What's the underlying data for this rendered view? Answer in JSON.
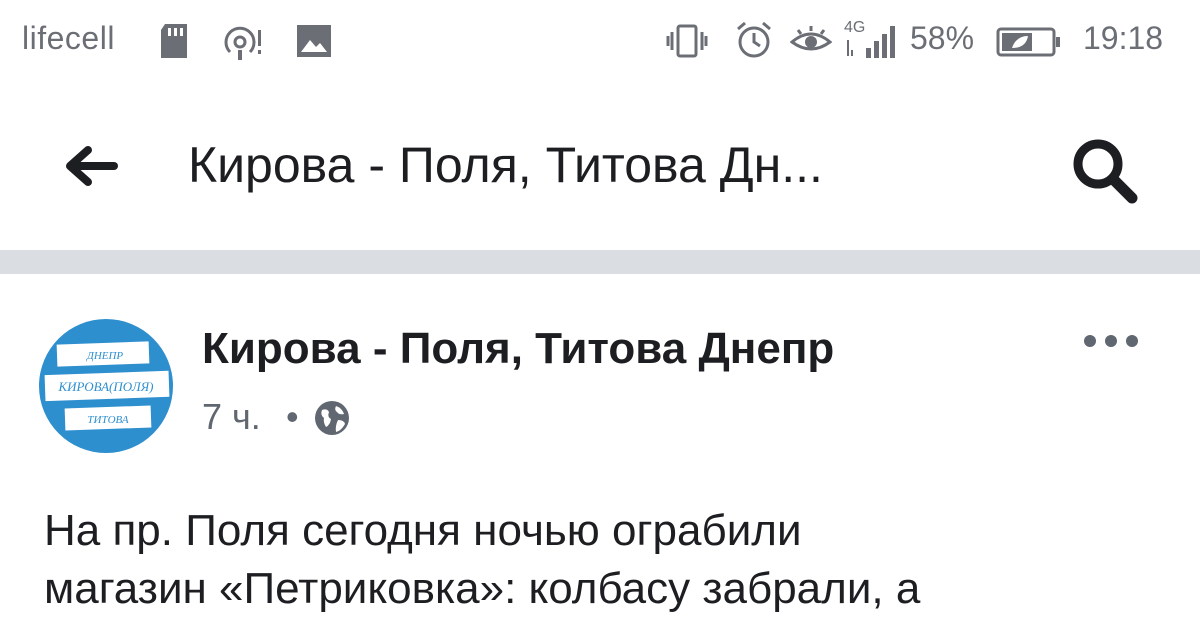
{
  "status_bar": {
    "carrier": "lifecell",
    "network": "4G",
    "battery_percent": "58%",
    "time": "19:18",
    "icons": [
      "sd-card-icon",
      "hotspot-icon",
      "image-icon",
      "vibrate-icon",
      "alarm-icon",
      "eye-comfort-icon",
      "signal-icon",
      "battery-icon"
    ]
  },
  "header": {
    "title": "Кирова - Поля, Титова Дн...",
    "back_icon": "arrow-left-icon",
    "search_icon": "search-icon"
  },
  "post": {
    "page_name": "Кирова - Поля, Титова Днепр",
    "time": "7 ч.",
    "separator": "•",
    "privacy_icon": "globe-icon",
    "more_icon": "more-dots-icon",
    "avatar": {
      "lines": [
        "ДНЕПР",
        "КИРОВА(ПОЛЯ)",
        "ТИТОВА"
      ],
      "colors": {
        "background": "#2e8fcf",
        "stripe": "#ffffff"
      }
    },
    "text_lines": [
      "На пр. Поля сегодня ночью ограбили",
      "магазин «Петриковка»: колбасу забрали, а"
    ]
  },
  "colors": {
    "status_text": "#6b6f75",
    "primary_text": "#1c1e21",
    "secondary_text": "#606770",
    "separator": "#dadde1"
  }
}
